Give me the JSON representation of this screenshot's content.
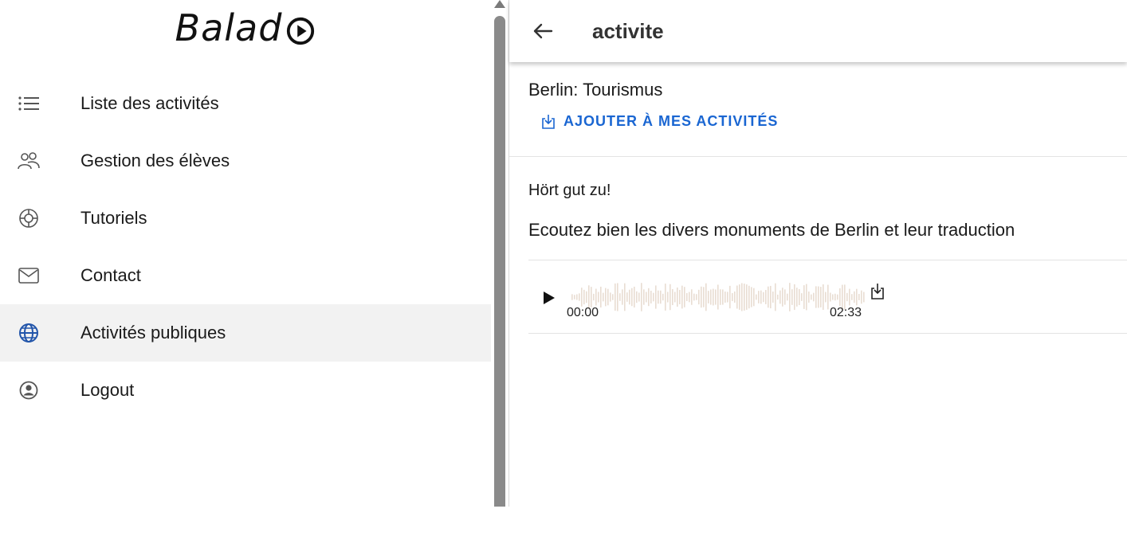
{
  "app": {
    "logo_text": "Balad",
    "window_title": "activite"
  },
  "sidebar": {
    "items": [
      {
        "label": "Liste des activités",
        "icon": "list-icon"
      },
      {
        "label": "Gestion des élèves",
        "icon": "people-icon"
      },
      {
        "label": "Tutoriels",
        "icon": "lifebuoy-icon"
      },
      {
        "label": "Contact",
        "icon": "mail-icon"
      },
      {
        "label": "Activités publiques",
        "icon": "globe-icon",
        "active": true
      },
      {
        "label": "Logout",
        "icon": "account-circle-icon"
      }
    ]
  },
  "main": {
    "activity_name": "Berlin: Tourismus",
    "add_button_label": "AJOUTER À MES ACTIVITÉS",
    "subtitle": "Hört gut zu!",
    "description": "Ecoutez bien les divers monuments de Berlin et leur traduction",
    "audio": {
      "time_start": "00:00",
      "time_end": "02:33",
      "progress": 0
    }
  },
  "colors": {
    "accent": "#1a66d2",
    "active_bg": "#f2f2f2",
    "waveform": "#e8ddd2"
  }
}
